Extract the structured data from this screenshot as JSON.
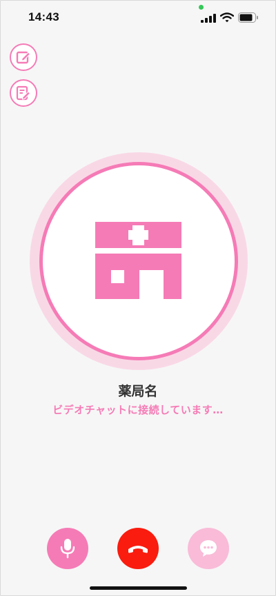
{
  "status_bar": {
    "time": "14:43",
    "icons": [
      "signal-icon",
      "wifi-icon",
      "battery-icon"
    ]
  },
  "tools": {
    "items": [
      "edit-note-icon",
      "edit-record-icon"
    ]
  },
  "call": {
    "pharmacy_name": "薬局名",
    "status": "ビデオチャットに接続しています…",
    "avatar_icon": "pharmacy-icon"
  },
  "controls": {
    "items": [
      "microphone-icon",
      "end-call-icon",
      "chat-icon"
    ]
  },
  "colors": {
    "accent": "#f57bb6",
    "accent_light": "#f9d8e6",
    "end_call": "#f91c0f",
    "background": "#f6f6f6"
  }
}
